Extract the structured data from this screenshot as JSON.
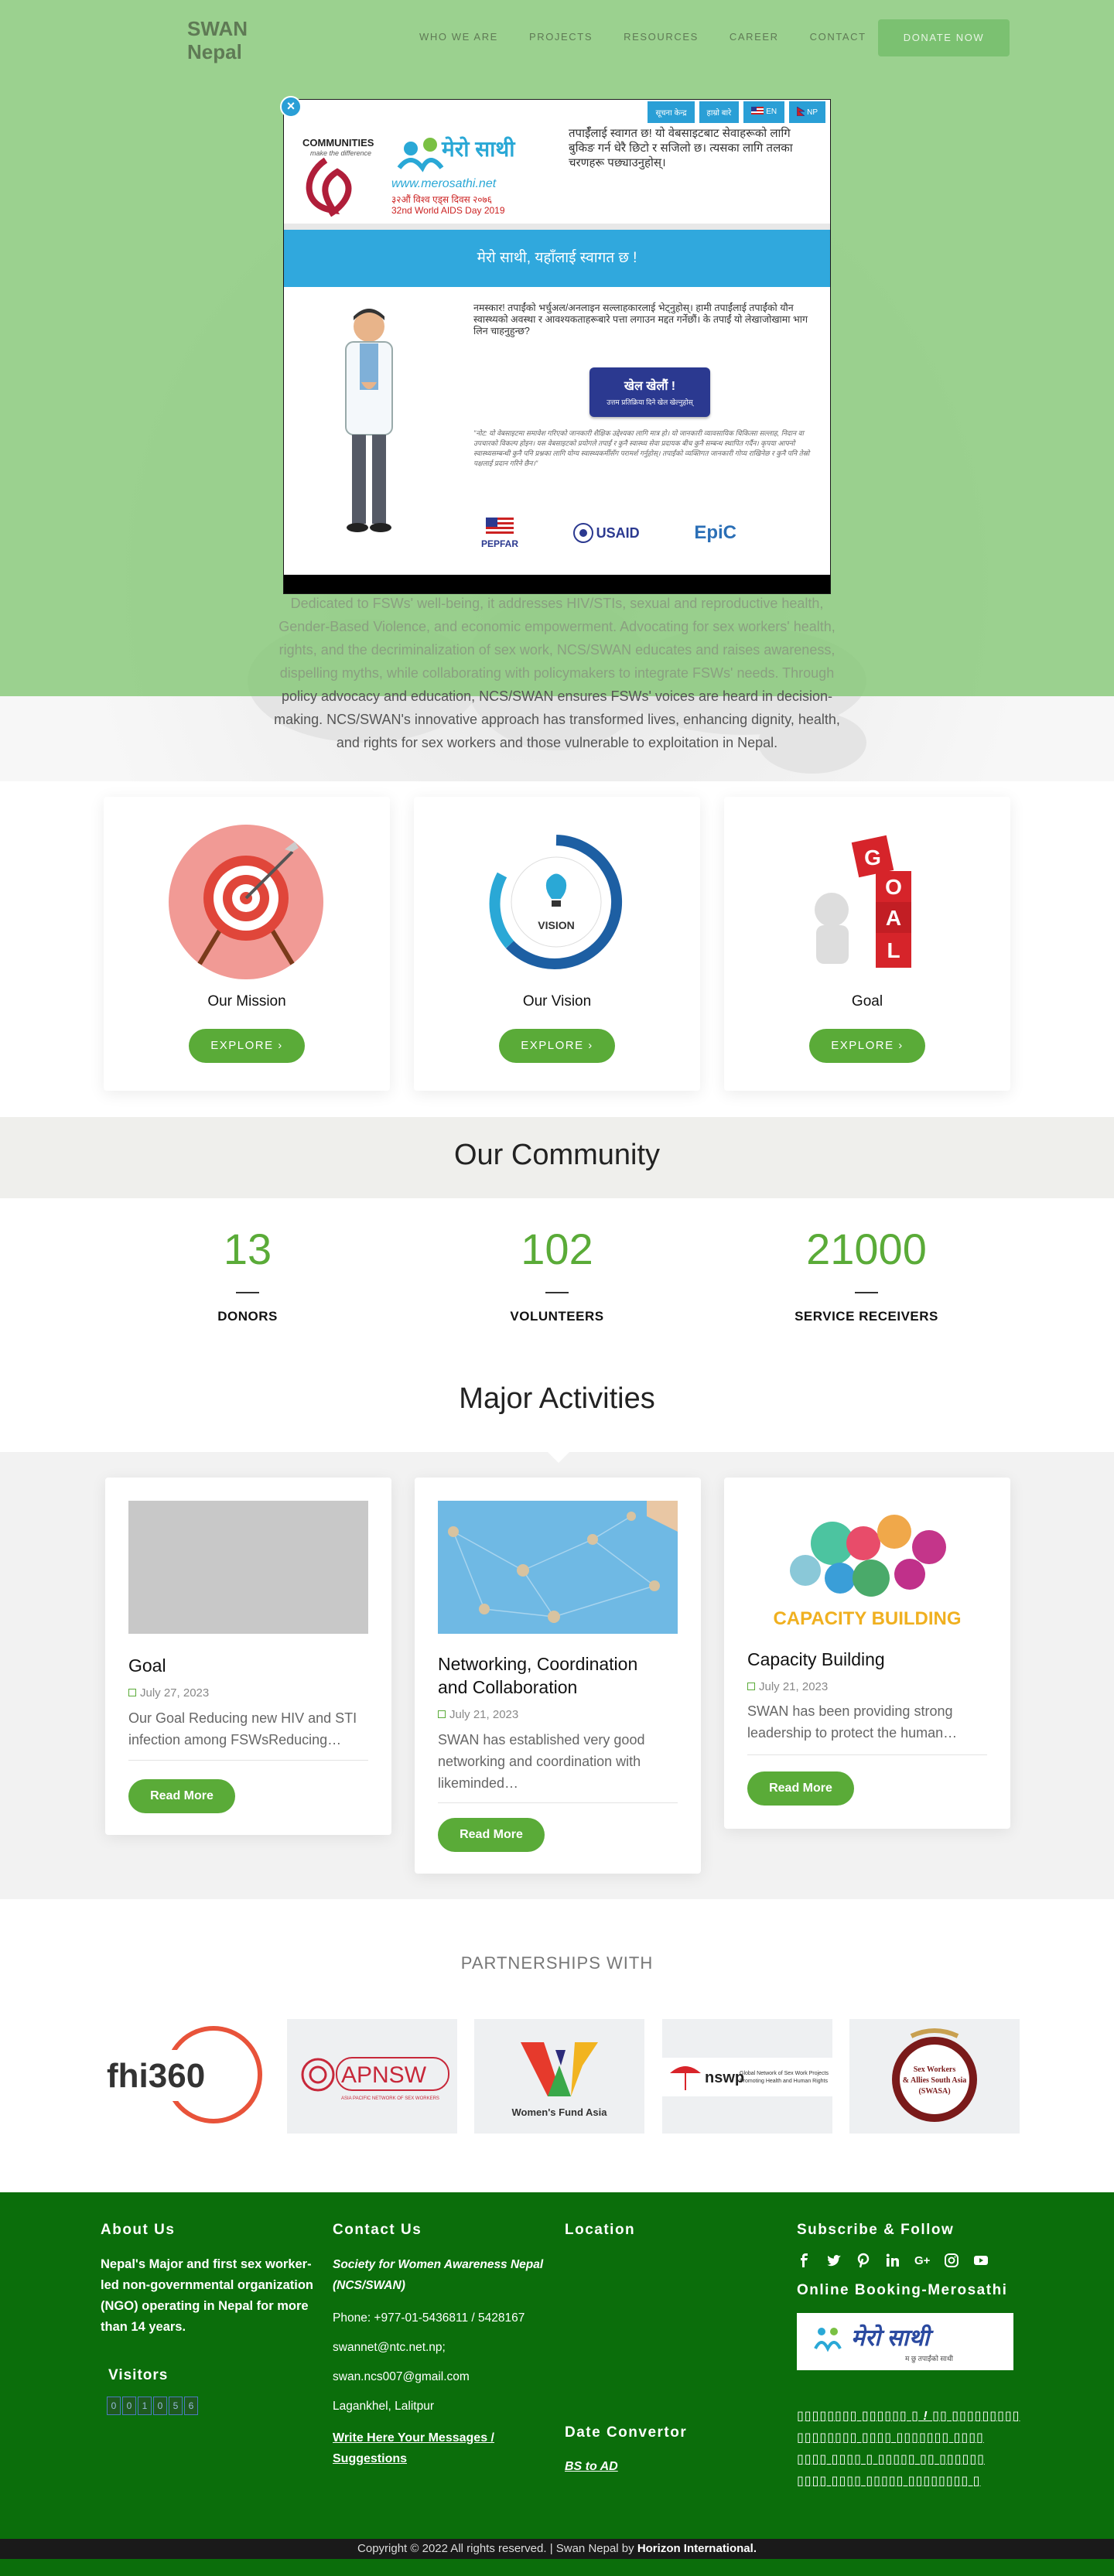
{
  "header": {
    "logo_line1": "SWAN",
    "logo_line2": "Nepal",
    "nav": [
      "WHO WE ARE",
      "PROJECTS",
      "RESOURCES",
      "CAREER",
      "CONTACT"
    ],
    "donate": "DONATE NOW"
  },
  "popup": {
    "close": "×",
    "menu": [
      "सूचना केन्द्र",
      "हाम्रो बारे",
      "EN",
      "NP"
    ],
    "logo_communities": "COMMUNITIES",
    "logo_tagline": "make the difference",
    "logo_merosathi": "मेरो साथी",
    "logo_url": "www.merosathi.net",
    "logo_day_np": "३२औं विश्व एड्स दिवस २०७६",
    "logo_day_en": "32nd World AIDS Day 2019",
    "welcome_text": "तपाईँलाई स्वागत छ! यो वेबसाइटबाट सेवाहरूको लागि बुकिङ गर्न धेरै छिटो र सजिलो छ। त्यसका लागि तलका चरणहरू पछ्याउनुहोस्।",
    "banner": "मेरो साथी, यहाँलाई स्वागत छ !",
    "body_text": "नमस्कार! तपाईंको भर्चुअल/अनलाइन सल्लाहकारलाई भेट्नुहोस्। हामी तपाईंलाई तपाईंको यौन स्वास्थ्यको अवस्था र आवश्यकताहरूबारे पत्ता लगाउन मद्दत गर्नेछौं। के तपाईं यो लेखाजोखामा भाग लिन चाहनुहुन्छ?",
    "play_label": "खेल खेलौं !",
    "play_sub": "उत्तम प्रतिक्रिया दिने खेल खेल्नुहोस्",
    "disclaimer": "\"नोट: यो वेबसाइटमा समावेश गरिएको जानकारी शैक्षिक उद्देश्यका लागि मात्र हो। यो जानकारी व्यावसायिक चिकित्सा सल्लाह, निदान वा उपचारको विकल्प होइन। यस वेबसाइटको प्रयोगले तपाईं र कुनै स्वास्थ्य सेवा प्रदायक बीच कुनै सम्बन्ध स्थापित गर्दैन। कृपया आफ्नो स्वास्थ्यसम्बन्धी कुनै पनि प्रश्नका लागि योग्य स्वास्थ्यकर्मीसँग परामर्श गर्नुहोस्। तपाईंको व्यक्तिगत जानकारी गोप्य राखिनेछ र कुनै पनि तेस्रो पक्षलाई प्रदान गरिने छैन।\"",
    "sponsors": [
      "PEPFAR",
      "USAID",
      "EpiC"
    ]
  },
  "hero": {
    "paragraph": "National Community-led and FSWs-led network, SWAN is the advocacy voice for FSWs. Dedicated to FSWs' well-being, it addresses HIV/STIs, sexual and reproductive health, Gender-Based Violence, and economic empowerment. Advocating for sex workers' health, rights, and the decriminalization of sex work, NCS/SWAN educates and raises awareness, dispelling myths, while collaborating with policymakers to integrate FSWs' needs. Through policy advocacy and education, NCS/SWAN ensures FSWs' voices are heard in decision-making. NCS/SWAN's innovative approach has transformed lives, enhancing dignity, health, and rights for sex workers and those vulnerable to exploitation in Nepal.",
    "line1": "Dedicated to FSWs' well-being, it addresses HIV/STIs, sexual and reproductive health,",
    "line2": "Gender-Based Violence, and economic empowerment. Advocating for sex workers' health,",
    "line3": "rights, and the decriminalization of sex work, NCS/SWAN educates and raises awareness,",
    "line4": "dispelling myths, while collaborating with policymakers to integrate FSWs' needs. Through",
    "line5": "policy advocacy and education, NCS/SWAN ensures FSWs' voices are heard in decision-",
    "line6": "making. NCS/SWAN's innovative approach has transformed lives, enhancing dignity, health,",
    "line7": "and rights for sex workers and those vulnerable to exploitation in Nepal."
  },
  "mvg": [
    {
      "title": "Our Mission",
      "button": "EXPLORE ›"
    },
    {
      "title": "Our Vision",
      "button": "EXPLORE ›",
      "img_text": "VISION"
    },
    {
      "title": "Goal",
      "button": "EXPLORE ›",
      "img_letters": [
        "G",
        "O",
        "A",
        "L"
      ]
    }
  ],
  "community": {
    "title": "Our Community",
    "stats": [
      {
        "value": "13",
        "label": "DONORS"
      },
      {
        "value": "102",
        "label": "VOLUNTEERS"
      },
      {
        "value": "21000",
        "label": "SERVICE RECEIVERS"
      }
    ]
  },
  "activities": {
    "title": "Major Activities",
    "items": [
      {
        "title": "Goal",
        "date": "July 27, 2023",
        "excerpt_1": "Our Goal Reducing new HIV and STI",
        "excerpt_2": "infection among FSWsReducing…",
        "button": "Read More"
      },
      {
        "title_1": "Networking, Coordination",
        "title_2": "and Collaboration",
        "date": "July 21, 2023",
        "excerpt_1": "SWAN has established very good",
        "excerpt_2": "networking and coordination with",
        "excerpt_3": "likeminded…",
        "button": "Read More"
      },
      {
        "title": "Capacity Building",
        "date": "July 21, 2023",
        "excerpt_1": "SWAN has been providing strong",
        "excerpt_2": "leadership to protect the human…",
        "button": "Read More",
        "img_caption": "CAPACITY BUILDING"
      }
    ]
  },
  "partners": {
    "title": "PARTNERSHIPS WITH",
    "items": [
      "fhi360",
      "APNSW",
      "Women's Fund Asia",
      "nswp",
      "SWASA"
    ],
    "apnsw_sub": "ASIA PACIFIC NETWORK OF SEX WORKERS",
    "nswp_sub": "Global Network of Sex Work Projects",
    "nswp_sub2": "Promoting Health and Human Rights",
    "swasa_lines": [
      "Sex Workers",
      "& Allies South Asia",
      "(SWASA)"
    ]
  },
  "footer": {
    "about_h": "About Us",
    "about_text": "Nepal's Major and first sex worker-led non-governmental organization (NGO) operating in Nepal for more than 14 years.",
    "visitors_h": "Visitors",
    "counter": [
      "0",
      "0",
      "1",
      "0",
      "5",
      "6"
    ],
    "contact_h": "Contact Us",
    "contact_org": "Society for Women Awareness Nepal (NCS/SWAN)",
    "phone": "Phone: +977-01-5436811 / 5428167",
    "email1": "swannet@ntc.net.np;",
    "email2": "swan.ncs007@gmail.com",
    "address": "Lagankhel, Lalitpur",
    "write_link": "Write Here Your Messages / Suggestions",
    "location_h": "Location",
    "date_h": "Date Convertor",
    "bs_link": "BS to AD",
    "subscribe_h": "Subscribe & Follow",
    "socials": [
      "facebook-icon",
      "twitter-icon",
      "pinterest-icon",
      "linkedin-icon",
      "google-plus-icon",
      "instagram-icon",
      "youtube-icon"
    ],
    "booking_h": "Online Booking-Merosathi",
    "booking_logo": "मेरो साथी",
    "booking_logo_sub": "म छु तपाईंको साथी",
    "box_line1": "▯▯▯▯▯▯▯▯ ▯▯▯▯▯▯ ▯ ! ▯▯ ▯▯▯▯▯▯▯▯▯",
    "box_line2": "▯▯▯▯▯▯▯▯ ▯▯▯▯ ▯▯▯▯▯▯▯ ▯▯▯▯",
    "box_line3": "▯▯▯▯ ▯▯▯▯ ▯ ▯▯▯▯▯ ▯▯ ▯▯▯▯▯▯",
    "box_line4": "▯▯▯▯ ▯▯▯▯ ▯▯▯▯▯ ▯▯▯▯▯▯▯▯ ▯",
    "copyright": "Copyright © 2022 All rights reserved. | Swan Nepal by ",
    "copyright_brand": "Horizon International."
  },
  "colors": {
    "green_overlay": "#86c878",
    "brand_green": "#5aab38",
    "footer_green": "#0b6e0b",
    "popup_blue": "#30a8dd"
  }
}
